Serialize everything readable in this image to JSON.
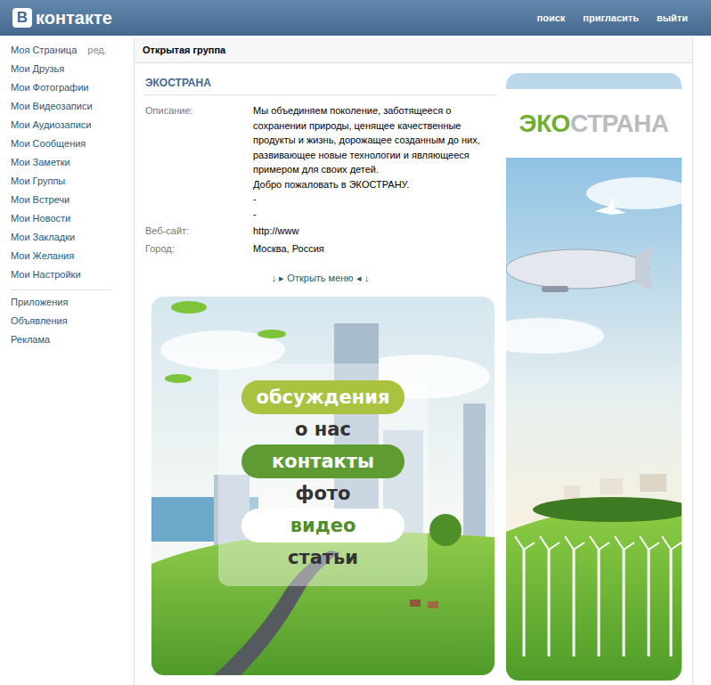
{
  "header": {
    "logo": {
      "mark": "В",
      "text": "контакте"
    },
    "nav": [
      "поиск",
      "пригласить",
      "выйти"
    ]
  },
  "sidebar": {
    "profile": {
      "label": "Моя Страница",
      "edit": "ред."
    },
    "items": [
      "Мои Друзья",
      "Мои Фотографии",
      "Мои Видеозаписи",
      "Мои Аудиозаписи",
      "Мои Сообщения",
      "Мои Заметки",
      "Мои Группы",
      "Мои Встречи",
      "Мои Новости",
      "Мои Закладки",
      "Мои Желания",
      "Мои Настройки"
    ],
    "extra": [
      "Приложения",
      "Объявления",
      "Реклама"
    ]
  },
  "group": {
    "type": "Открытая группа",
    "name": "ЭКОСТРАНА",
    "info": [
      {
        "label": "Описание:",
        "lines": [
          "Мы объединяем поколение, заботящееся о сохранении природы, ценящее качественные продукты и жизнь, дорожащее созданным до них, развивающее новые технологии и являющееся примером для своих детей.",
          "Добро пожаловать в ЭКОСТРАНУ.",
          "-",
          "-"
        ]
      },
      {
        "label": "Веб-сайт:",
        "lines": [
          "http://www"
        ]
      },
      {
        "label": "Город:",
        "lines": [
          "Москва, Россия"
        ]
      }
    ],
    "menu_toggle": "↓ ▸ Открыть меню ◂ ↓",
    "wiki_menu": [
      {
        "label": "обсуждения",
        "kind": "light"
      },
      {
        "label": "о нас",
        "kind": "plain"
      },
      {
        "label": "контакты",
        "kind": "dark"
      },
      {
        "label": "фото",
        "kind": "plain"
      },
      {
        "label": "видео",
        "kind": "white"
      },
      {
        "label": "статьи",
        "kind": "plain"
      }
    ],
    "avatar": {
      "logo_left": "ЭКО",
      "logo_right": "СТРАНА"
    }
  }
}
